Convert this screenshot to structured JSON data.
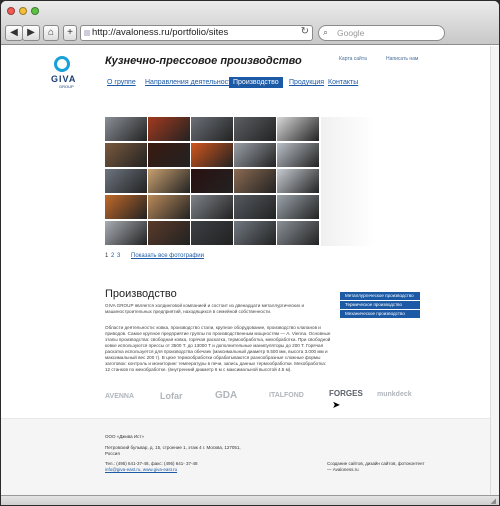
{
  "browser": {
    "url": "http://avaloness.ru/portfolio/sites",
    "search_placeholder": "Google",
    "back_icon": "◀",
    "forward_icon": "▶",
    "home_icon": "⌂",
    "add_icon": "+",
    "reload_icon": "↻",
    "search_icon": "⌕"
  },
  "site": {
    "logo_text": "GIVA",
    "logo_sub": "GROUP",
    "title": "Кузнечно-прессовое производство",
    "util_links": [
      "Карта сайта",
      "Написать нам"
    ],
    "nav": [
      {
        "label": "О группе",
        "active": false
      },
      {
        "label": "Направления деятельности",
        "active": false
      },
      {
        "label": "Производство",
        "active": true
      },
      {
        "label": "Продукция",
        "active": false
      },
      {
        "label": "Контакты",
        "active": false
      }
    ],
    "pager": [
      "1",
      "2",
      "3"
    ],
    "show_all": "Показать все фотографии",
    "section_title": "Производство",
    "intro": "GIVA GROUP является холдинговой компанией и состоит из двенадцати металлургических и машиностроительных предприятий, находящихся в семейной собственности.",
    "body": "Области деятельности: ковка, производство стали, крупное оборудование, производство клапанов и приводов. Самое крупное предприятие группы по производственным мощностям — A. Vienna. Основные этапы производства: свободная ковка, горячая раскатка, термообработка, мехобработка. При свободной ковке используются прессы от 3500 Т. до 13000 Т и дополнительные манипуляторы до 200 Т. Горячая раскатка используется для производства обечаек (максимальный диаметр 9.500 мм, высота 3.000 мм и максимальный вес 200 т). В цехе термообработки обрабатываются разнообразные сложные формы заготовок: контроль и мониторинг температуры в печи, запись данных термообработки. Мехобработка: 12 станков по мехобработке. (внутренний диаметр 6 м с максимальной высотой 4.5 м).",
    "side_links": [
      "Металлургическое производство",
      "Термическое производство",
      "Механическое производство"
    ],
    "partners": [
      "AVENNA",
      "Lofar",
      "GDA",
      "ITALFOND",
      "FORGES",
      "munkdeck"
    ],
    "footer": {
      "company": "ООО «Джива Ист»",
      "address": "Петровский бульвар, д. 15, строение 1, этаж 4 г. Москва, 127051, Россия",
      "phone": "Тел.: (495) 641-37-48, факс: (495) 641- 37-48",
      "email": "info@giva-east.ru, www.giva-east.ru",
      "credits": "Создание сайтов, дизайн сайтов, фотоконтент — Avaloness.ru"
    }
  },
  "colors": {
    "accent": "#1c5aa6",
    "logo_blue": "#1aa0d8"
  }
}
